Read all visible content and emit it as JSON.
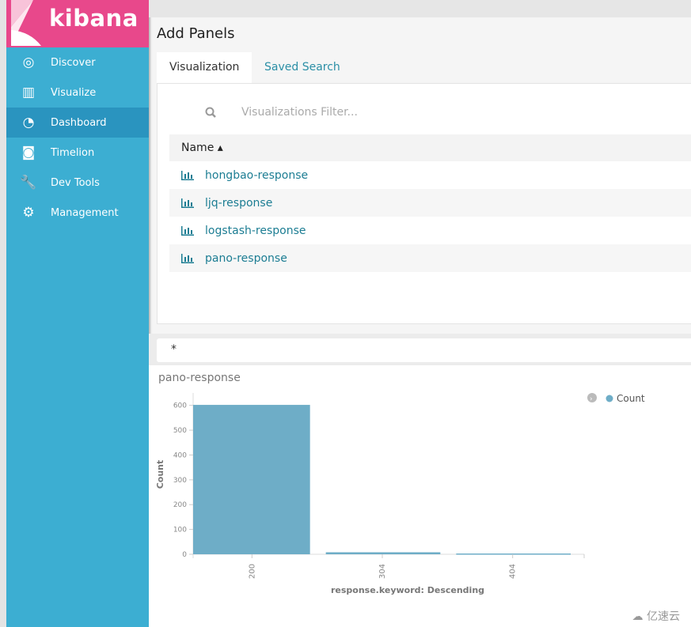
{
  "sidebar": {
    "brand": "kibana",
    "brand_color": "#e8488b",
    "color": "#3caed2",
    "items": [
      {
        "label": "Discover",
        "icon": "compass-icon"
      },
      {
        "label": "Visualize",
        "icon": "bar-chart-icon"
      },
      {
        "label": "Dashboard",
        "icon": "dashboard-gauge-icon",
        "active": true
      },
      {
        "label": "Timelion",
        "icon": "bear-icon"
      },
      {
        "label": "Dev Tools",
        "icon": "wrench-icon"
      },
      {
        "label": "Management",
        "icon": "gear-icon"
      }
    ]
  },
  "add_panels": {
    "title": "Add Panels",
    "tabs": [
      {
        "label": "Visualization",
        "active": true
      },
      {
        "label": "Saved Search"
      }
    ],
    "filter_placeholder": "Visualizations Filter...",
    "column": "Name ▴",
    "items": [
      "hongbao-response",
      "ljq-response",
      "logstash-response",
      "pano-response"
    ]
  },
  "query": "*",
  "visualization": {
    "title": "pano-response"
  },
  "chart_data": {
    "type": "bar",
    "categories": [
      "200",
      "304",
      "404"
    ],
    "series": [
      {
        "name": "Count",
        "values": [
          602,
          8,
          3
        ],
        "color": "#6eadc7"
      }
    ],
    "xlabel": "response.keyword: Descending",
    "ylabel": "Count",
    "ylim": [
      0,
      650
    ],
    "yticks": [
      0,
      100,
      200,
      300,
      400,
      500,
      600
    ],
    "grid": false,
    "legend": "top-right"
  },
  "watermark": "亿速云"
}
